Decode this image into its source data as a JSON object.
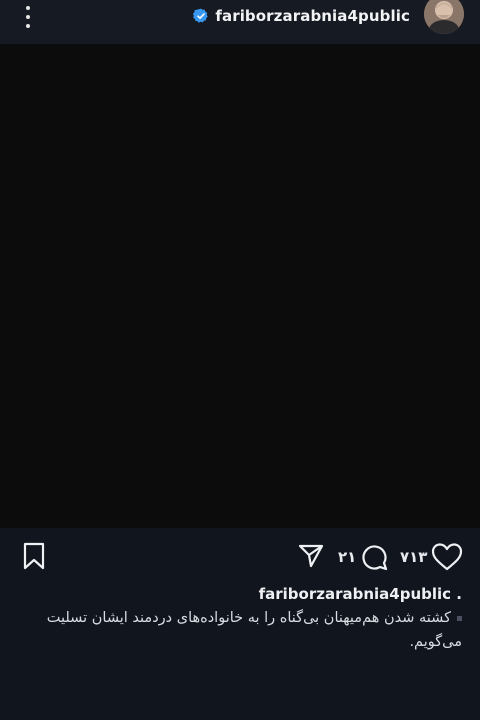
{
  "header": {
    "menu_icon": "more-vertical-icon",
    "verified_icon": "verified-badge-icon",
    "verified_color": "#3897f0",
    "username": "fariborzarabnia4public",
    "avatar": "profile-avatar"
  },
  "post": {
    "media_color": "#0c0c0d",
    "actions": {
      "like_icon": "heart-icon",
      "like_count": "۷۱۳",
      "comment_icon": "comment-icon",
      "comment_count": "۲۱",
      "share_icon": "send-icon",
      "save_icon": "bookmark-icon"
    },
    "caption_username": "fariborzarabnia4public .",
    "caption_text": "کشته شدن هم‌میهنان بی‌گناه را به خانواده‌های دردمند ایشان تسلیت می‌گویم."
  }
}
